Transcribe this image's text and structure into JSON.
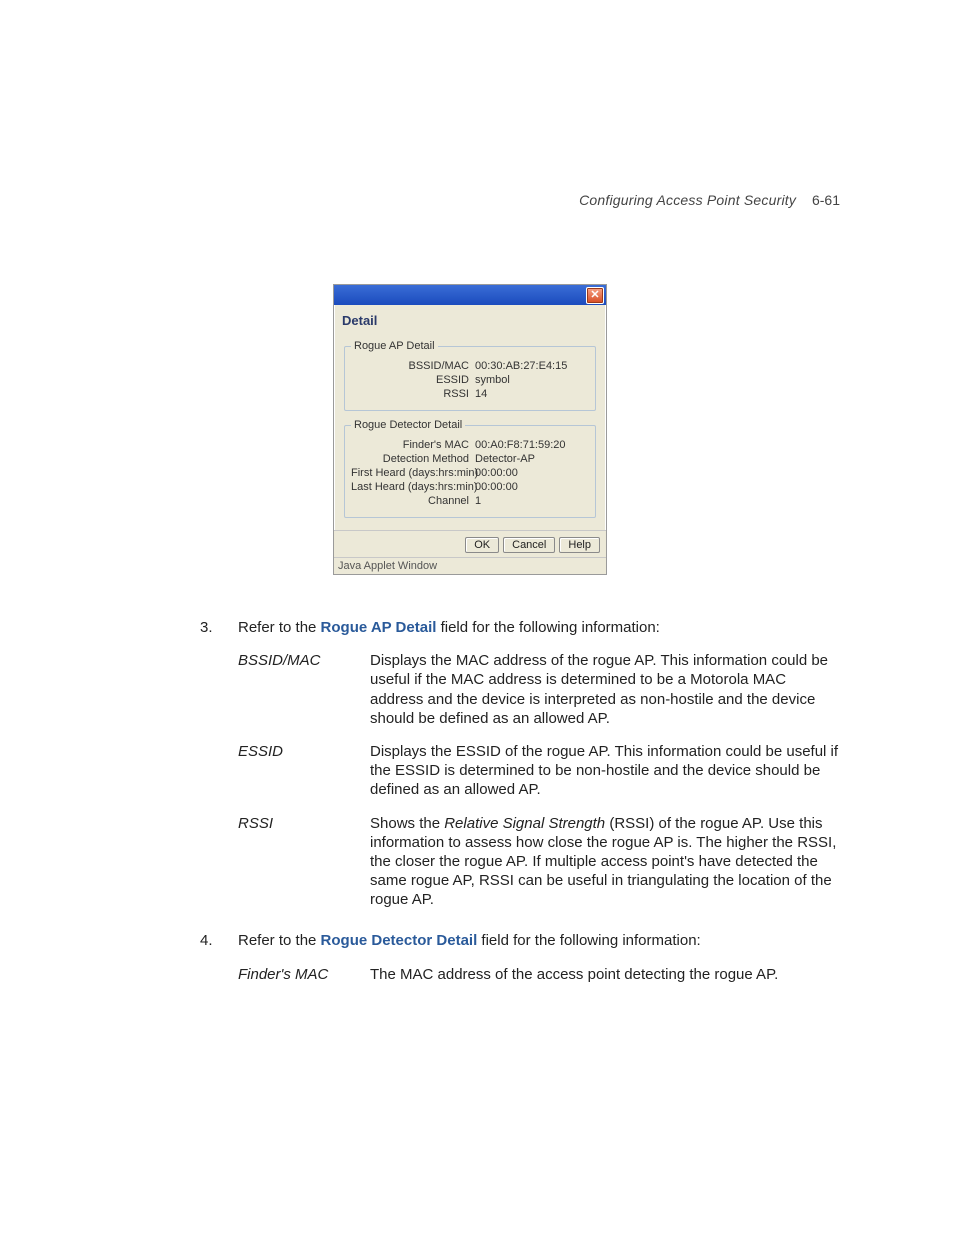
{
  "header": {
    "title": "Configuring Access Point Security",
    "page_number": "6-61"
  },
  "dialog": {
    "close_glyph": "✕",
    "heading": "Detail",
    "group1": {
      "legend": "Rogue AP Detail",
      "bssid_mac_label": "BSSID/MAC",
      "bssid_mac_value": "00:30:AB:27:E4:15",
      "essid_label": "ESSID",
      "essid_value": "symbol",
      "rssi_label": "RSSI",
      "rssi_value": "14"
    },
    "group2": {
      "legend": "Rogue Detector Detail",
      "finders_mac_label": "Finder's MAC",
      "finders_mac_value": "00:A0:F8:71:59:20",
      "detection_method_label": "Detection Method",
      "detection_method_value": "Detector-AP",
      "first_heard_label": "First Heard (days:hrs:min)",
      "first_heard_value": "00:00:00",
      "last_heard_label": "Last Heard (days:hrs:min)",
      "last_heard_value": "00:00:00",
      "channel_label": "Channel",
      "channel_value": "1"
    },
    "buttons": {
      "ok": "OK",
      "cancel": "Cancel",
      "help": "Help"
    },
    "statusbar": "Java Applet Window"
  },
  "steps": {
    "s3": {
      "num": "3.",
      "pre": "Refer to the ",
      "bold": "Rogue AP Detail",
      "post": " field for the following information:"
    },
    "s4": {
      "num": "4.",
      "pre": "Refer to the ",
      "bold": "Rogue Detector Detail",
      "post": " field for the following information:"
    }
  },
  "defs1": {
    "bssid": {
      "term": "BSSID/MAC",
      "desc": "Displays the MAC address of the rogue AP. This information could be useful if the MAC address is determined to be a Motorola MAC address and the device is interpreted as non-hostile and the device should be defined as an allowed AP."
    },
    "essid": {
      "term": "ESSID",
      "desc": "Displays the ESSID of the rogue AP. This information could be useful if the ESSID is determined to be non-hostile and the device should be defined as an allowed AP."
    },
    "rssi": {
      "term": "RSSI",
      "desc_pre": "Shows the ",
      "desc_em": "Relative Signal Strength",
      "desc_post": " (RSSI) of the rogue AP. Use this information to assess how close the rogue AP is. The higher the RSSI, the closer the rogue AP. If multiple access point's have detected the same rogue AP, RSSI can be useful in triangulating the location of the rogue AP."
    }
  },
  "defs2": {
    "finders_mac": {
      "term": "Finder's MAC",
      "desc": "The MAC address of the access point detecting the rogue AP."
    }
  }
}
